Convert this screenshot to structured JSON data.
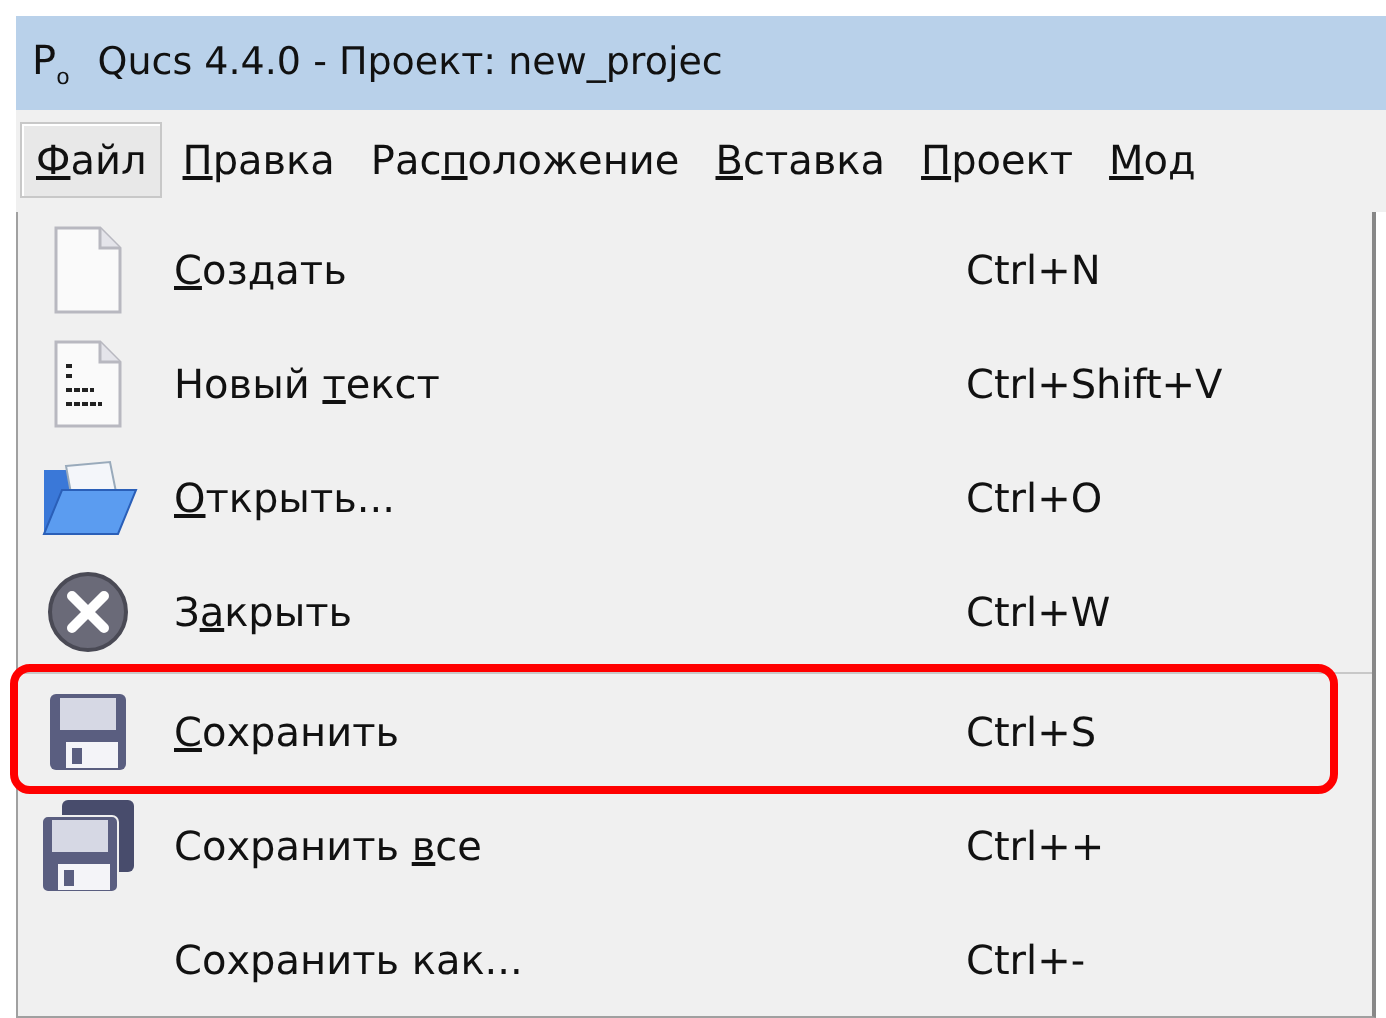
{
  "window": {
    "logo": "P$_{o}$",
    "title": "Qucs 4.4.0 - Проект: new_projec"
  },
  "menubar": [
    {
      "key": "Ф",
      "after": "айл",
      "selected": true
    },
    {
      "key": "П",
      "after": "равка",
      "selected": false
    },
    {
      "before": "Рас",
      "key": "п",
      "after": "оложение",
      "selected": false
    },
    {
      "key": "В",
      "after": "ставка",
      "selected": false
    },
    {
      "key": "П",
      "after": "роект",
      "selected": false
    },
    {
      "key": "М",
      "after": "од",
      "selected": false
    }
  ],
  "menu": [
    {
      "kind": "document",
      "label": {
        "key": "С",
        "after": "оздать"
      },
      "shortcut": "Ctrl+N",
      "separator_before": false,
      "highlighted": false
    },
    {
      "kind": "text",
      "label": {
        "before": "Новый ",
        "key": "т",
        "after": "екст"
      },
      "shortcut": "Ctrl+Shift+V",
      "separator_before": false,
      "highlighted": false
    },
    {
      "kind": "open",
      "label": {
        "key": "О",
        "after": "ткрыть..."
      },
      "shortcut": "Ctrl+O",
      "separator_before": false,
      "highlighted": false
    },
    {
      "kind": "close",
      "label": {
        "before": "З",
        "key": "а",
        "after": "крыть"
      },
      "shortcut": "Ctrl+W",
      "separator_before": false,
      "highlighted": false
    },
    {
      "kind": "save",
      "label": {
        "key": "С",
        "after": "охранить"
      },
      "shortcut": "Ctrl+S",
      "separator_before": true,
      "highlighted": true
    },
    {
      "kind": "saveall",
      "label": {
        "before": "Сохранить ",
        "key": "в",
        "after": "се"
      },
      "shortcut": "Ctrl++",
      "separator_before": false,
      "highlighted": false
    },
    {
      "kind": "plain",
      "label": {
        "before": "Сохранить как..."
      },
      "shortcut": "Ctrl+-",
      "separator_before": false,
      "highlighted": false
    }
  ]
}
